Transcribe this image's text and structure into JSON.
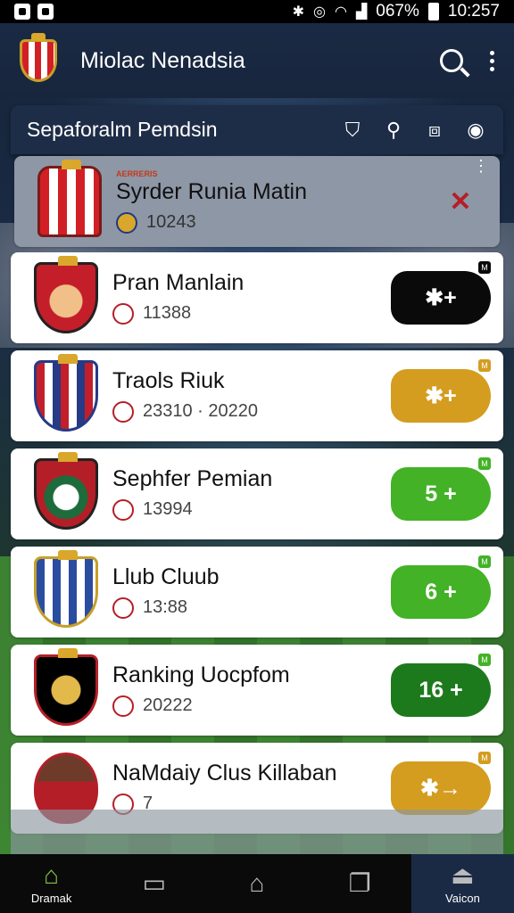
{
  "status_bar": {
    "battery": "067%",
    "time": "10:257"
  },
  "app_bar": {
    "title": "Miolac Nenadsia"
  },
  "panel": {
    "title": "Sepaforalm Pemdsin",
    "icons": [
      "shield-icon",
      "whistle-icon",
      "camera-icon",
      "clock-icon"
    ]
  },
  "rows": [
    {
      "tag": "AERRERIS",
      "name": "Syrder Runia Matin",
      "sub": "10243",
      "action": "✕",
      "corner": "⋮"
    },
    {
      "name": "Pran Manlain",
      "sub": "11388",
      "action": "✱+",
      "corner": "M"
    },
    {
      "name": "Traols Riuk",
      "sub": "23310 · 20220",
      "action": "✱+",
      "corner": "M"
    },
    {
      "name": "Sephfer Pemian",
      "sub": "13994",
      "action": "5 +",
      "corner": "M"
    },
    {
      "name": "Llub Cluub",
      "sub": "13:88",
      "action": "6 +",
      "corner": "M"
    },
    {
      "name": "Ranking Uocpfom",
      "sub": "20222",
      "action": "16 +",
      "corner": "M"
    },
    {
      "name": "NaMdaiy Clus Killaban",
      "sub": "7",
      "action": "✱→",
      "corner": "M"
    }
  ],
  "bottom_nav": [
    {
      "label": "Dramak",
      "icon": "home-icon"
    },
    {
      "label": "",
      "icon": "chat-icon"
    },
    {
      "label": "",
      "icon": "house-outline-icon"
    },
    {
      "label": "",
      "icon": "windows-icon"
    },
    {
      "label": "Vaicon",
      "icon": "download-icon"
    }
  ],
  "colors": {
    "accent_green": "#43b226",
    "accent_gold": "#d49d20",
    "header": "#1b2a44"
  }
}
